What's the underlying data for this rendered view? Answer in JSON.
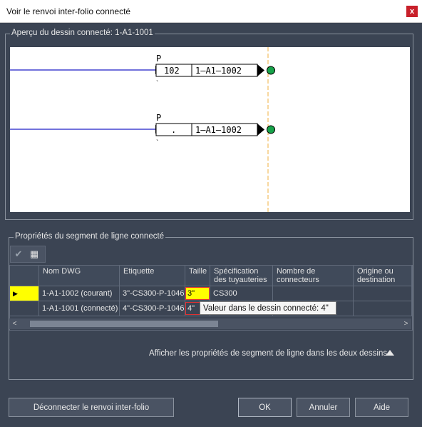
{
  "window": {
    "title": "Voir le renvoi inter-folio connecté",
    "close_label": "x"
  },
  "preview": {
    "group_label": "Aperçu du dessin connecté: 1-A1-1001",
    "connectors": [
      {
        "label": "P",
        "number": "102",
        "drawing": "1–A1–1002"
      },
      {
        "label": "P",
        "number": ".",
        "drawing": "1–A1–1002"
      }
    ]
  },
  "properties": {
    "group_label": "Propriétés du segment de ligne connecté",
    "toolbar": [
      {
        "icon": "checkmark-icon"
      },
      {
        "icon": "grid-settings-icon"
      }
    ],
    "columns": [
      "Nom DWG",
      "Etiquette",
      "Taille",
      "Spécification des tuyauteries",
      "Nombre de connecteurs",
      "Origine ou destination"
    ],
    "rows": [
      {
        "dwg": "1-A1-1002  (courant)",
        "tag": "3\"-CS300-P-1046",
        "size": "3\"",
        "spec": "CS300",
        "connectors": "",
        "origin": ""
      },
      {
        "dwg": "1-A1-1001  (connecté)",
        "tag": "4\"-CS300-P-1046",
        "size": "4\"",
        "spec": "",
        "connectors": "",
        "origin": ""
      }
    ],
    "tooltip": "Valeur dans le dessin connecté:  4\"",
    "expand_text": "Afficher les propriétés de segment de ligne dans les deux dessins"
  },
  "buttons": {
    "disconnect": "Déconnecter le renvoi inter-folio",
    "ok": "OK",
    "cancel": "Annuler",
    "help": "Aide"
  },
  "colors": {
    "highlight": "#ffff00",
    "background": "#3b4453",
    "close": "#c8202a"
  }
}
